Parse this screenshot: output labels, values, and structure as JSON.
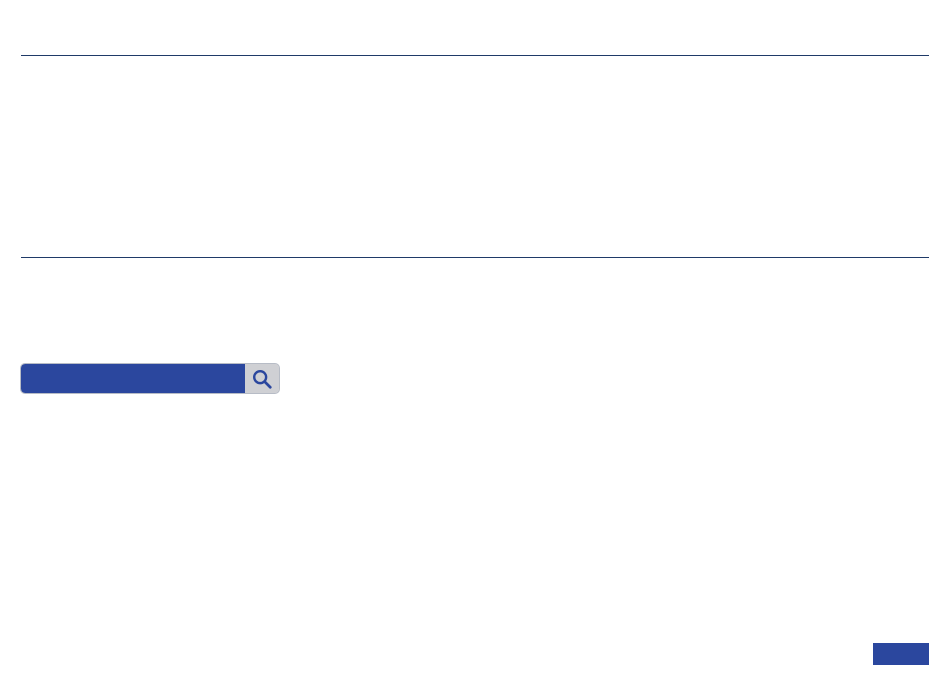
{
  "search": {
    "value": "",
    "placeholder": "",
    "icon": "search-icon"
  },
  "colors": {
    "divider": "#1f3a68",
    "accent": "#2b479e",
    "search_button_bg": "#cfd0d4"
  },
  "corner_button": {
    "label": ""
  }
}
